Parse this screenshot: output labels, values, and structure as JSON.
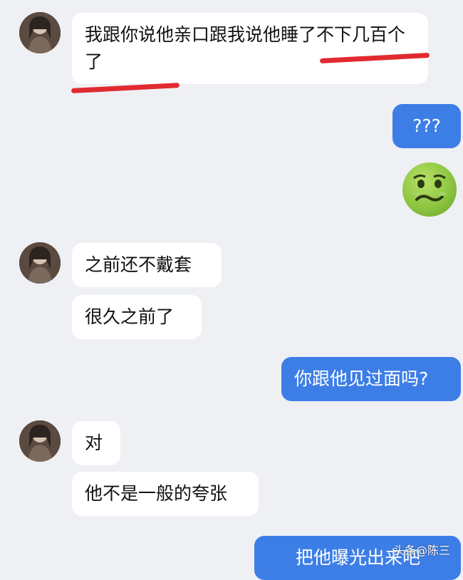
{
  "messages": [
    {
      "side": "in",
      "text": "我跟你说他亲口跟我说他睡了不下几百个了"
    },
    {
      "side": "out",
      "text": "???"
    },
    {
      "side": "out",
      "emoji": "nauseated-face"
    },
    {
      "side": "in",
      "text": "之前还不戴套"
    },
    {
      "side": "in",
      "text": "很久之前了"
    },
    {
      "side": "out",
      "text": "你跟他见过面吗?"
    },
    {
      "side": "in",
      "text": "对"
    },
    {
      "side": "in",
      "text": "他不是一般的夸张"
    },
    {
      "side": "out",
      "text": "把他曝光出来吧"
    }
  ],
  "watermark": "头条@陈三",
  "colors": {
    "background": "#eef0f4",
    "incoming_bubble": "#ffffff",
    "outgoing_bubble": "#3d7ee6",
    "underline": "#e12a2f"
  }
}
